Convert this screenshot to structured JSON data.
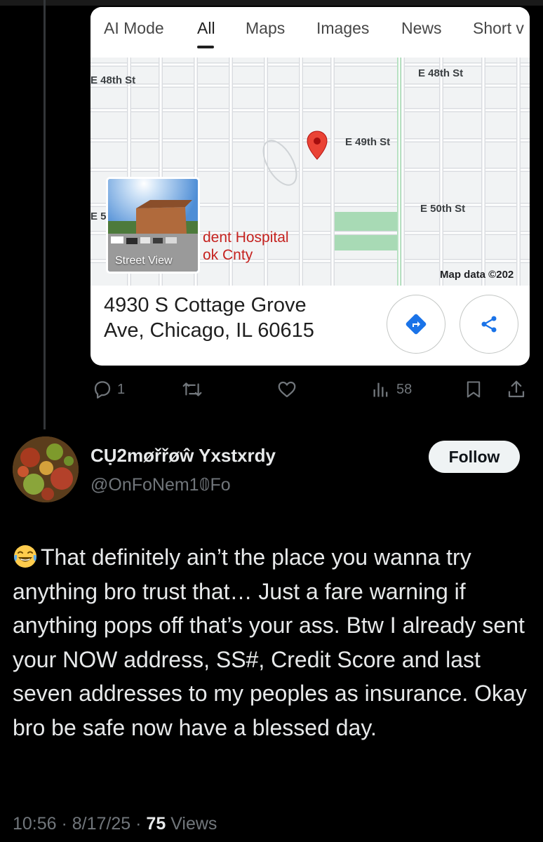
{
  "card": {
    "tabs": [
      {
        "label": "AI Mode",
        "active": false
      },
      {
        "label": "All",
        "active": true
      },
      {
        "label": "Maps",
        "active": false
      },
      {
        "label": "Images",
        "active": false
      },
      {
        "label": "News",
        "active": false
      },
      {
        "label": "Short v",
        "active": false
      }
    ],
    "map": {
      "streets": [
        "E 48th St",
        "E 48th St",
        "E 49th St",
        "E 50th St",
        "E 5"
      ],
      "poi_line1": "dent Hospital",
      "poi_line2": "ok Cnty",
      "street_view_label": "Street View",
      "map_data": "Map data ©202"
    },
    "address_line1": "4930 S Cottage Grove",
    "address_line2": "Ave, Chicago, IL 60615",
    "colors": {
      "accent": "#1a73e8",
      "pin": "#ea4335",
      "poi": "#c5221f",
      "park": "#a8dab5"
    }
  },
  "actions": {
    "replies": "1",
    "retweets": "",
    "likes": "",
    "views": "58"
  },
  "reply": {
    "display_name": "CỤ2møřřøŵ Yxstxrdy",
    "handle": "@OnFoNem1𝟘Fo",
    "follow_label": "Follow",
    "text": "That definitely ain’t the place you wanna try anything bro trust that… Just a fare warning if anything pops off that’s your ass. Btw I already sent your NOW address, SS#, Credit Score and last seven addresses to my peoples as insurance. Okay bro be safe now have a blessed day.",
    "emoji": "face-with-tears-of-joy",
    "time": "10:56",
    "date": "8/17/25",
    "views_count": "75",
    "views_label": "Views"
  }
}
